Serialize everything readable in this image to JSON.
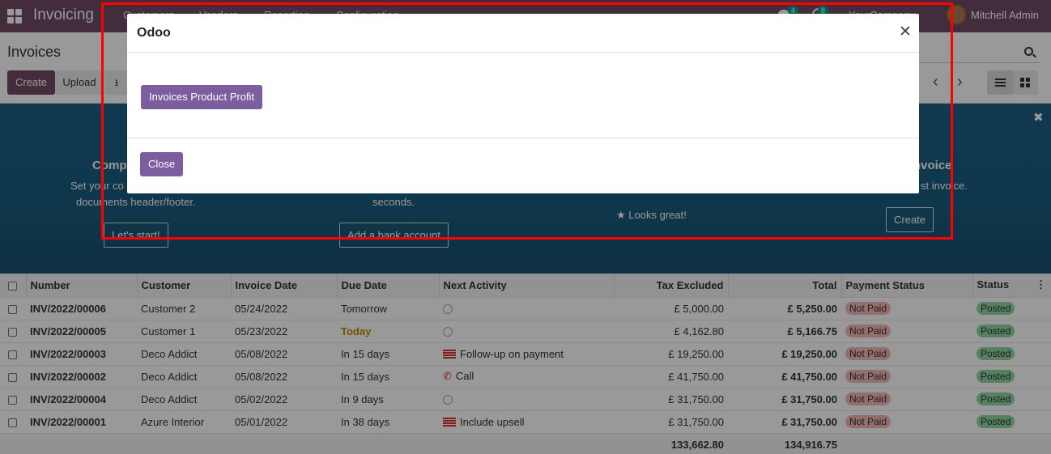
{
  "topbar": {
    "app_name": "Invoicing",
    "menu": [
      "Customers",
      "Vendors",
      "Reporting",
      "Configuration"
    ],
    "chat_badge": "4",
    "activity_badge": "8",
    "company": "YourCompany",
    "user": "Mitchell Admin"
  },
  "control": {
    "title": "Invoices",
    "create_label": "Create",
    "upload_label": "Upload"
  },
  "onboarding": {
    "step1_title": "Comp",
    "step1_text_line1": "Set your co",
    "step1_text_line2": "documents header/footer.",
    "step1_button": "Let's start!",
    "step2_text": "seconds.",
    "step2_button": "Add a bank account",
    "step3_done": "Looks great!",
    "step4_title": "nvoice",
    "step4_text": "st invoice.",
    "step4_button": "Create"
  },
  "table": {
    "columns": [
      "Number",
      "Customer",
      "Invoice Date",
      "Due Date",
      "Next Activity",
      "Tax Excluded",
      "Total",
      "Payment Status",
      "Status"
    ],
    "rows": [
      {
        "number": "INV/2022/00006",
        "customer": "Customer 2",
        "invoice_date": "05/24/2022",
        "due_date": "Tomorrow",
        "activity_icon": "clock-icon",
        "activity": "",
        "tax_excluded": "£ 5,000.00",
        "total": "£ 5,250.00",
        "payment_status": "Not Paid",
        "status": "Posted"
      },
      {
        "number": "INV/2022/00005",
        "customer": "Customer 1",
        "invoice_date": "05/23/2022",
        "due_date": "Today",
        "activity_icon": "clock-icon",
        "activity": "",
        "tax_excluded": "£ 4,162.80",
        "total": "£ 5,166.75",
        "payment_status": "Not Paid",
        "status": "Posted"
      },
      {
        "number": "INV/2022/00003",
        "customer": "Deco Addict",
        "invoice_date": "05/08/2022",
        "due_date": "In 15 days",
        "activity_icon": "flag-icon",
        "activity": "Follow-up on payment",
        "tax_excluded": "£ 19,250.00",
        "total": "£ 19,250.00",
        "payment_status": "Not Paid",
        "status": "Posted"
      },
      {
        "number": "INV/2022/00002",
        "customer": "Deco Addict",
        "invoice_date": "05/08/2022",
        "due_date": "In 15 days",
        "activity_icon": "phone-icon",
        "activity": "Call",
        "tax_excluded": "£ 41,750.00",
        "total": "£ 41,750.00",
        "payment_status": "Not Paid",
        "status": "Posted"
      },
      {
        "number": "INV/2022/00004",
        "customer": "Deco Addict",
        "invoice_date": "05/02/2022",
        "due_date": "In 9 days",
        "activity_icon": "clock-icon",
        "activity": "",
        "tax_excluded": "£ 31,750.00",
        "total": "£ 31,750.00",
        "payment_status": "Not Paid",
        "status": "Posted"
      },
      {
        "number": "INV/2022/00001",
        "customer": "Azure Interior",
        "invoice_date": "05/01/2022",
        "due_date": "In 38 days",
        "activity_icon": "flag-icon",
        "activity": "Include upsell",
        "tax_excluded": "£ 31,750.00",
        "total": "£ 31,750.00",
        "payment_status": "Not Paid",
        "status": "Posted"
      }
    ],
    "total_tax_excluded": "133,662.80",
    "total_total": "134,916.75"
  },
  "modal": {
    "title": "Odoo",
    "report_button": "Invoices Product Profit",
    "close_button": "Close"
  },
  "colors": {
    "brand": "#714B67",
    "modal_button": "#7c5d9f",
    "highlight": "#ff0000"
  }
}
